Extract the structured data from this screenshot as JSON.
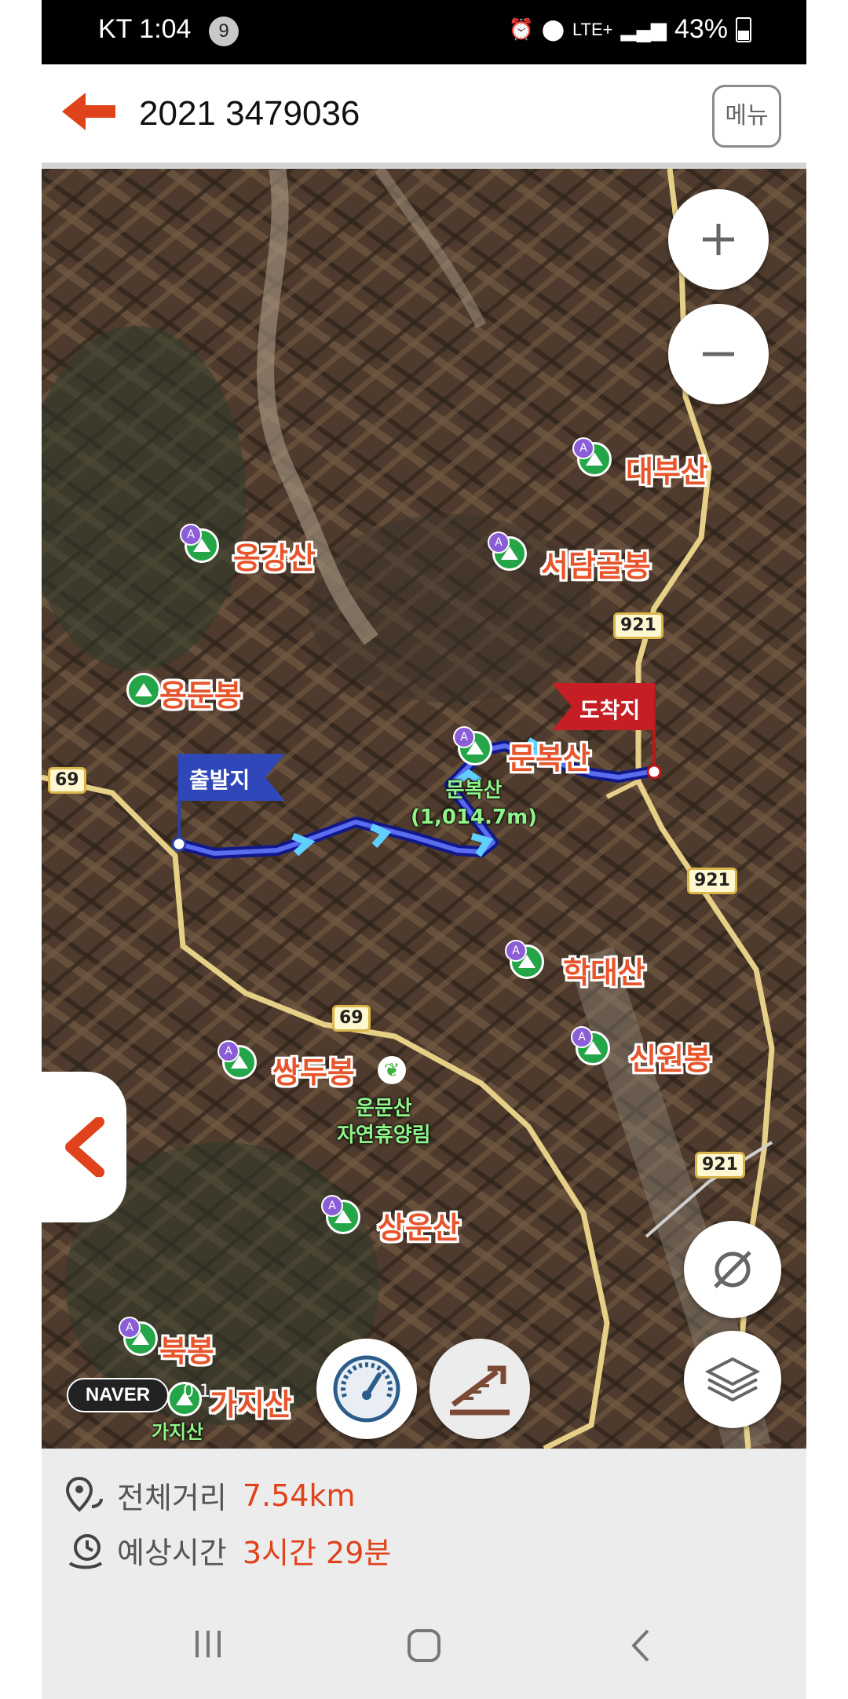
{
  "status_bar": {
    "carrier": "KT",
    "time": "1:04",
    "notification_count": "9",
    "network": "LTE+",
    "battery": "43%"
  },
  "header": {
    "title": "2021 3479036",
    "menu_label": "메뉴"
  },
  "map": {
    "flag_start": "출발지",
    "flag_end": "도착지",
    "peaks": [
      {
        "name": "대부산"
      },
      {
        "name": "옹강산"
      },
      {
        "name": "서담골봉"
      },
      {
        "name": "용둔봉"
      },
      {
        "name": "문복산"
      },
      {
        "name": "학대산"
      },
      {
        "name": "쌍두봉"
      },
      {
        "name": "신원봉"
      },
      {
        "name": "상운산"
      },
      {
        "name": "북봉"
      },
      {
        "name": "가지산"
      }
    ],
    "summit_label": "문복산",
    "summit_height": "(1,014.7m)",
    "forest_label_1": "운문산",
    "forest_label_2": "자연휴양림",
    "gaji_small": "가지산",
    "roads": {
      "r69": "69",
      "r921": "921"
    },
    "provider": "NAVER",
    "scale_text": "0    1"
  },
  "info": {
    "distance_label": "전체거리",
    "distance_value": "7.54km",
    "time_label": "예상시간",
    "time_value": "3시간 29분"
  },
  "colors": {
    "accent": "#e0421b",
    "route": "#2a3fd0",
    "peak_green": "#24a547",
    "label_orange": "#e8542b"
  }
}
